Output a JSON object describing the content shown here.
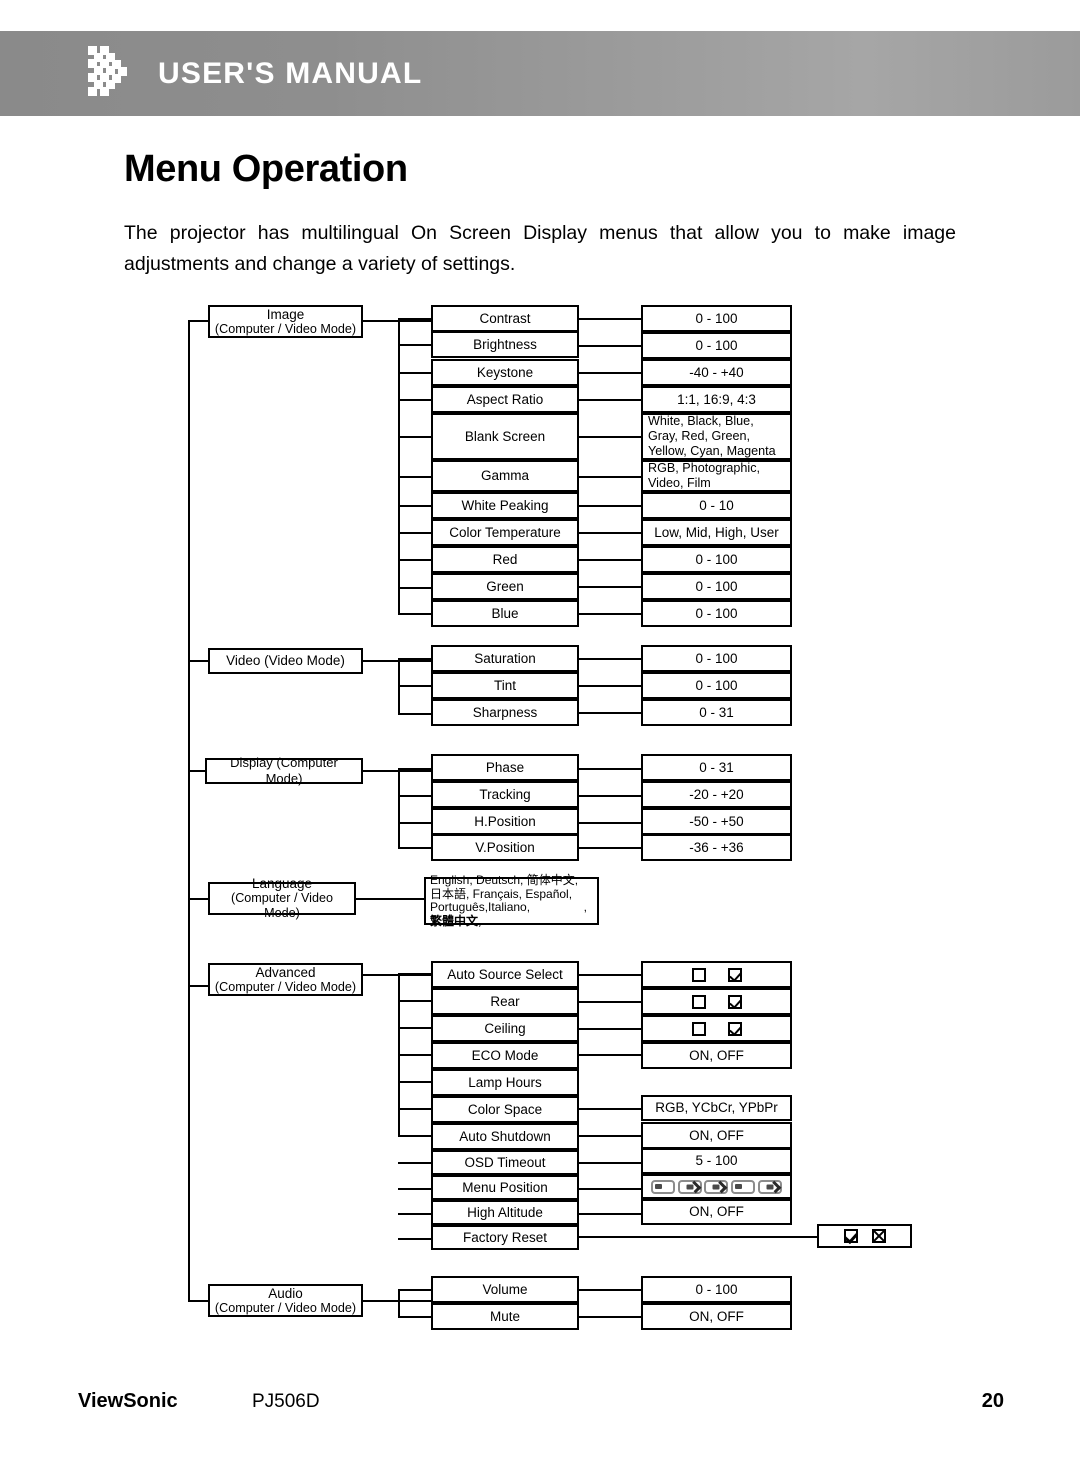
{
  "header": {
    "title": "USER'S MANUAL",
    "logo_icon": "pixel-chevron-logo",
    "band_color": "#8f8f8f"
  },
  "page": {
    "title": "Menu Operation",
    "intro": "The projector has multilingual On Screen Display menus that allow you to make image adjustments and change a variety of settings."
  },
  "footer": {
    "brand": "ViewSonic",
    "model": "PJ506D",
    "page_number": "20"
  },
  "diagram": {
    "groups": [
      {
        "name": "image",
        "label": "Image",
        "sublabel": "(Computer / Video Mode)",
        "items": [
          {
            "label": "Contrast",
            "value": "0 - 100"
          },
          {
            "label": "Brightness",
            "value": "0 - 100"
          },
          {
            "label": "Keystone",
            "value": "-40 - +40"
          },
          {
            "label": "Aspect Ratio",
            "value": "1:1, 16:9, 4:3"
          },
          {
            "label": "Blank Screen",
            "value": "White, Black, Blue, Gray, Red, Green, Yellow, Cyan, Magenta"
          },
          {
            "label": "Gamma",
            "value": "RGB, Photographic, Video, Film"
          },
          {
            "label": "White Peaking",
            "value": "0 - 10"
          },
          {
            "label": "Color Temperature",
            "value": "Low, Mid, High, User"
          },
          {
            "label": "Red",
            "value": "0 - 100"
          },
          {
            "label": "Green",
            "value": "0 - 100"
          },
          {
            "label": "Blue",
            "value": "0 - 100"
          }
        ]
      },
      {
        "name": "video",
        "label": "Video (Video Mode)",
        "sublabel": "",
        "items": [
          {
            "label": "Saturation",
            "value": "0 - 100"
          },
          {
            "label": "Tint",
            "value": "0 - 100"
          },
          {
            "label": "Sharpness",
            "value": "0 - 31"
          }
        ]
      },
      {
        "name": "display",
        "label": "Display (Computer Mode)",
        "sublabel": "",
        "items": [
          {
            "label": "Phase",
            "value": "0 - 31"
          },
          {
            "label": "Tracking",
            "value": "-20 - +20"
          },
          {
            "label": "H.Position",
            "value": "-50 - +50"
          },
          {
            "label": "V.Position",
            "value": "-36 - +36"
          }
        ]
      },
      {
        "name": "language",
        "label": "Language",
        "sublabel": "(Computer / Video Mode)",
        "options_line1": "English, Deutsch, 简体中文,",
        "options_line2": "日本語, Français, Español,",
        "options_line3": "Português,Italiano,",
        "options_line3b": ",",
        "options_line4": "繁體中文,"
      },
      {
        "name": "advanced",
        "label": "Advanced",
        "sublabel": "(Computer / Video Mode)",
        "items": [
          {
            "label": "Auto Source Select",
            "value": "",
            "value_type": "checkbox-pair"
          },
          {
            "label": "Rear",
            "value": "",
            "value_type": "checkbox-pair"
          },
          {
            "label": "Ceiling",
            "value": "",
            "value_type": "checkbox-pair"
          },
          {
            "label": "ECO Mode",
            "value": "ON, OFF"
          },
          {
            "label": "Lamp Hours",
            "value": ""
          },
          {
            "label": "Color Space",
            "value": "RGB, YCbCr, YPbPr"
          },
          {
            "label": "Auto Shutdown",
            "value": "ON, OFF"
          },
          {
            "label": "OSD Timeout",
            "value": "5 - 100"
          },
          {
            "label": "Menu Position",
            "value": "",
            "value_type": "menu-position-icons"
          },
          {
            "label": "High Altitude",
            "value": "ON, OFF"
          },
          {
            "label": "Factory Reset",
            "value": "",
            "value_type": "confirm-cancel"
          }
        ]
      },
      {
        "name": "audio",
        "label": "Audio",
        "sublabel": "(Computer / Video Mode)",
        "items": [
          {
            "label": "Volume",
            "value": "0 - 100"
          },
          {
            "label": "Mute",
            "value": "ON, OFF"
          }
        ]
      }
    ]
  }
}
